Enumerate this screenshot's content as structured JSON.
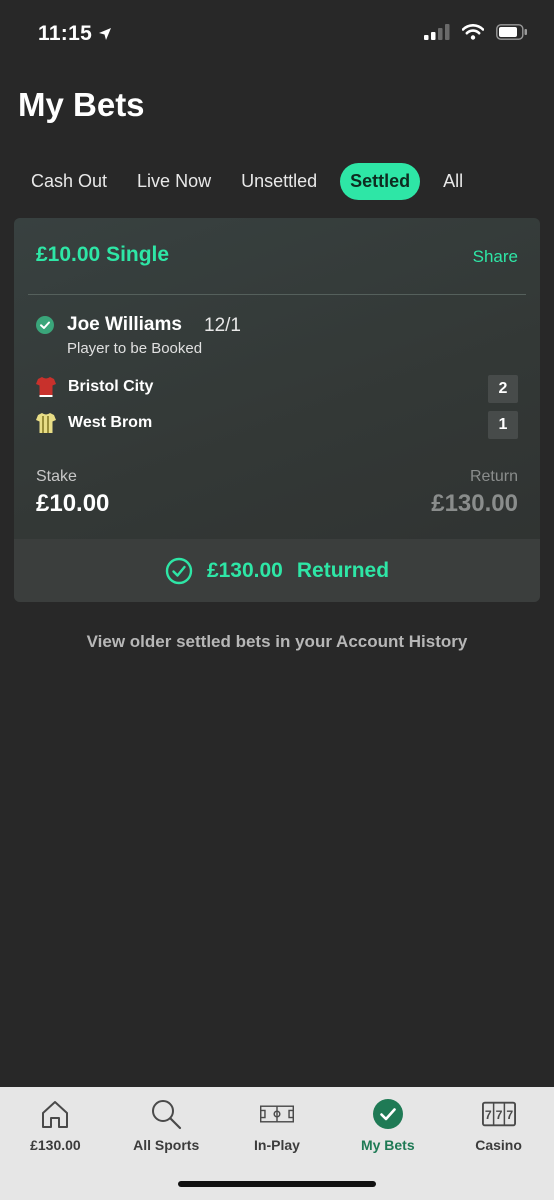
{
  "status_bar": {
    "time": "11:15"
  },
  "header": {
    "title": "My Bets"
  },
  "tabs": [
    {
      "label": "Cash Out",
      "active": false
    },
    {
      "label": "Live Now",
      "active": false
    },
    {
      "label": "Unsettled",
      "active": false
    },
    {
      "label": "Settled",
      "active": true
    },
    {
      "label": "All",
      "active": false
    }
  ],
  "bet": {
    "title": "£10.00 Single",
    "share_label": "Share",
    "selection": {
      "name": "Joe Williams",
      "odds": "12/1",
      "market": "Player to be Booked"
    },
    "teams": [
      {
        "name": "Bristol City",
        "score": "2",
        "kit_color": "#c8312c"
      },
      {
        "name": "West Brom",
        "score": "1",
        "kit_color": "#e8dd86"
      }
    ],
    "stake_label": "Stake",
    "stake_value": "£10.00",
    "return_label": "Return",
    "return_value": "£130.00",
    "returned_amount": "£130.00",
    "returned_label": "Returned"
  },
  "history_link": "View older settled bets in your Account History",
  "bottom_nav": [
    {
      "label": "£130.00",
      "icon": "home-icon",
      "active": false
    },
    {
      "label": "All Sports",
      "icon": "search-icon",
      "active": false
    },
    {
      "label": "In-Play",
      "icon": "pitch-icon",
      "active": false
    },
    {
      "label": "My Bets",
      "icon": "check-circle-icon",
      "active": true
    },
    {
      "label": "Casino",
      "icon": "slot-machine-icon",
      "active": false
    }
  ],
  "colors": {
    "accent": "#2ee6a6",
    "background": "#282828",
    "nav_active": "#1f7a55"
  }
}
